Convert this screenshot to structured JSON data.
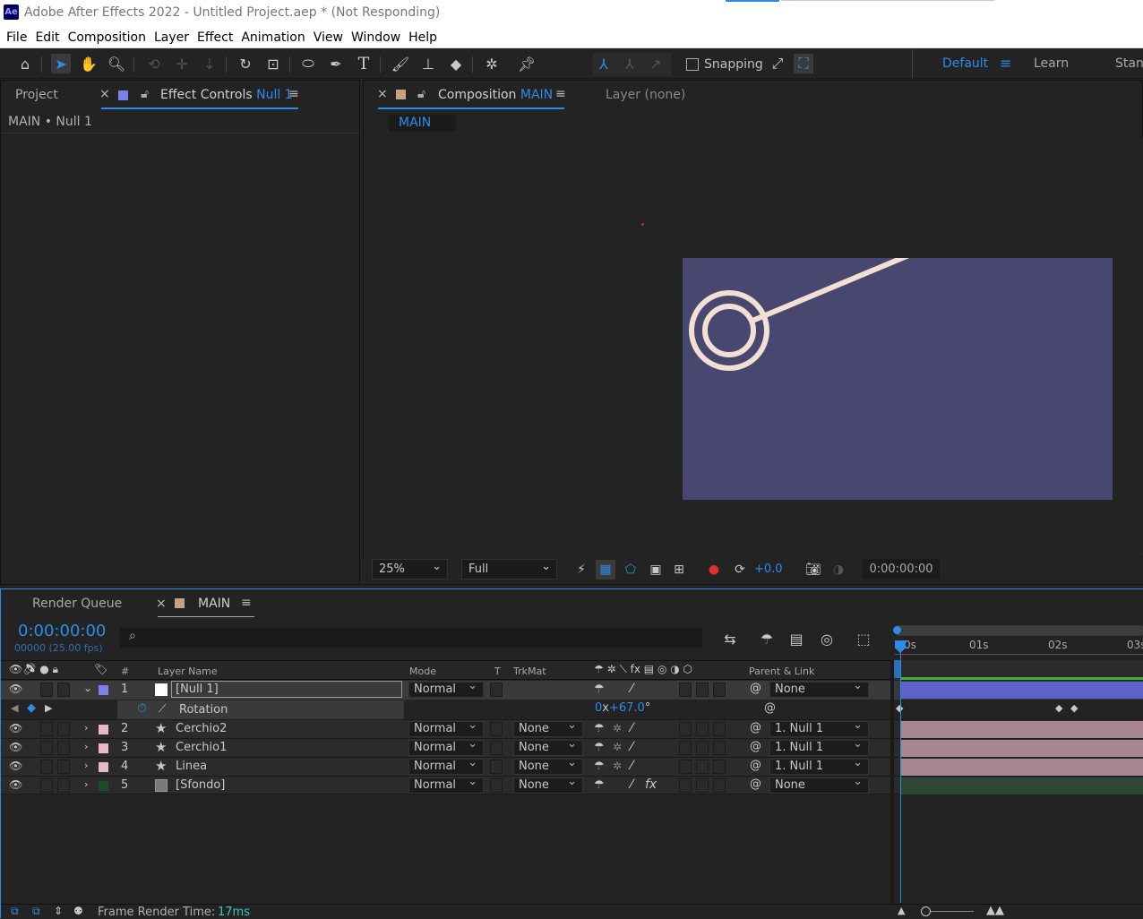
{
  "window": {
    "title": "Adobe After Effects 2022 - Untitled Project.aep * (Not Responding)",
    "logo": "Ae"
  },
  "menu": [
    "File",
    "Edit",
    "Composition",
    "Layer",
    "Effect",
    "Animation",
    "View",
    "Window",
    "Help"
  ],
  "toolbar": {
    "snapping_label": "Snapping",
    "workspace_default": "Default",
    "workspace_learn": "Learn",
    "workspace_standard": "Stanc"
  },
  "left_panel": {
    "tab_project": "Project",
    "tab_effect_controls": "Effect Controls",
    "effect_controls_target": "Null 1",
    "breadcrumb": "MAIN • Null 1"
  },
  "comp_panel": {
    "tab_label": "Composition",
    "comp_name": "MAIN",
    "layer_tab": "Layer",
    "layer_value": "(none)",
    "flowchart_tab": "MAIN"
  },
  "viewer_footer": {
    "zoom": "25%",
    "resolution": "Full",
    "exposure": "+0.0",
    "timecode": "0:00:00:00"
  },
  "timeline": {
    "tab_render_queue": "Render Queue",
    "tab_comp": "MAIN",
    "current_time": "0:00:00:00",
    "frame_info": "00000 (25.00 fps)",
    "search_placeholder": "",
    "columns": {
      "num": "#",
      "layer_name": "Layer Name",
      "mode": "Mode",
      "t": "T",
      "trkmat": "TrkMat",
      "parent": "Parent & Link"
    },
    "ruler": [
      "0s",
      "01s",
      "02s",
      "03s"
    ],
    "layers": [
      {
        "num": "1",
        "name": "[Null 1]",
        "mode": "Normal",
        "trkmat": "",
        "parent": "None"
      },
      {
        "num": "2",
        "name": "Cerchio2",
        "mode": "Normal",
        "trkmat": "None",
        "parent": "1. Null 1"
      },
      {
        "num": "3",
        "name": "Cerchio1",
        "mode": "Normal",
        "trkmat": "None",
        "parent": "1. Null 1"
      },
      {
        "num": "4",
        "name": "Linea",
        "mode": "Normal",
        "trkmat": "None",
        "parent": "1. Null 1"
      },
      {
        "num": "5",
        "name": "[Sfondo]",
        "mode": "Normal",
        "trkmat": "None",
        "parent": "None"
      }
    ],
    "property": {
      "name": "Rotation",
      "value_rev": "0",
      "value_x": "x",
      "value_deg": "+67.0",
      "unit": "°"
    },
    "status_label": "Frame Render Time:",
    "status_value": "17ms"
  },
  "colors": {
    "accent": "#2d8ceb",
    "comp_bg": "#48476f",
    "shape": "#f2e0d4",
    "null_label": "#7d80e6",
    "shape_label": "#e7b9cb",
    "solid_label": "#1f4b24",
    "null_bar": "#5b62c9",
    "shape_bar": "#a7868f",
    "solid_bar": "#304634"
  }
}
